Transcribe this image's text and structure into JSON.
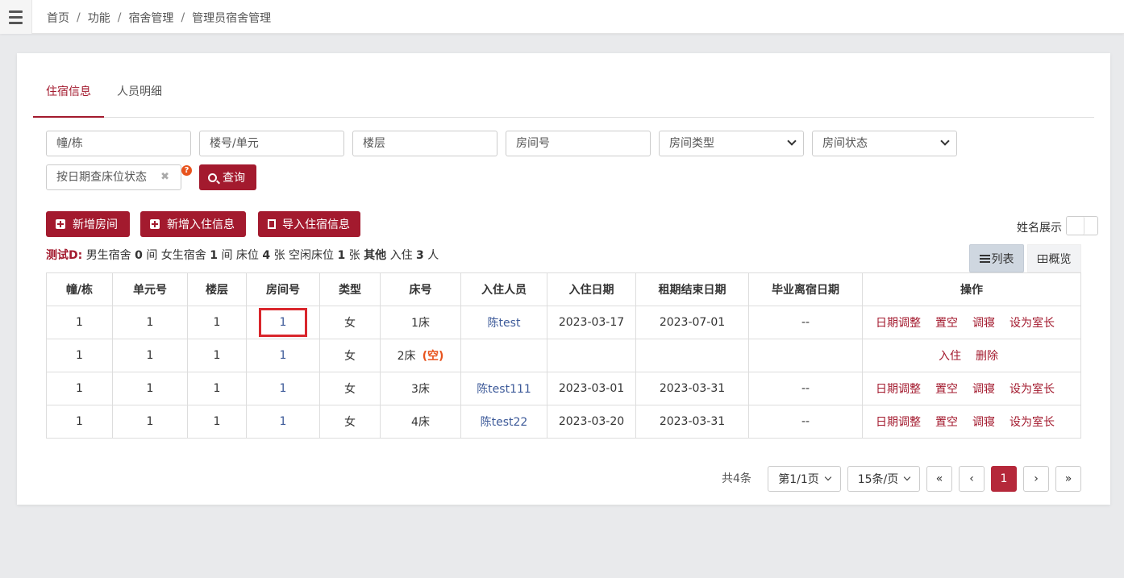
{
  "breadcrumb": [
    "首页",
    "功能",
    "宿舍管理",
    "管理员宿舍管理"
  ],
  "tabs": {
    "active": "住宿信息",
    "inactive": "人员明细"
  },
  "filters": {
    "building": "幢/栋",
    "unit": "楼号/单元",
    "floor": "楼层",
    "room": "房间号",
    "room_type": "房间类型",
    "room_status": "房间状态",
    "date_query": "按日期查床位状态",
    "query_btn": "查询"
  },
  "actions": {
    "add_room": "新增房间",
    "add_checkin": "新增入住信息",
    "import": "导入住宿信息"
  },
  "name_toggle": "姓名展示",
  "summary": {
    "label": "测试D:",
    "male_pre": "男生宿舍",
    "male_count": "0",
    "male_post": "间 女生宿舍",
    "female_count": "1",
    "female_post": "间 床位",
    "bed_count": "4",
    "bed_post": "张 空闲床位",
    "free_count": "1",
    "free_post": "张",
    "other": "其他",
    "checkin_pre": "入住",
    "checkin_count": "3",
    "checkin_post": "人"
  },
  "views": {
    "list": "列表",
    "overview": "概览"
  },
  "table": {
    "headers": [
      "幢/栋",
      "单元号",
      "楼层",
      "房间号",
      "类型",
      "床号",
      "入住人员",
      "入住日期",
      "租期结束日期",
      "毕业离宿日期",
      "操作"
    ],
    "rows": [
      {
        "building": "1",
        "unit": "1",
        "floor": "1",
        "room": "1",
        "type": "女",
        "bed": "1床",
        "empty": "",
        "person": "陈test",
        "in_date": "2023-03-17",
        "end_date": "2023-07-01",
        "grad_date": "--"
      },
      {
        "building": "1",
        "unit": "1",
        "floor": "1",
        "room": "1",
        "type": "女",
        "bed": "2床",
        "empty": "(空)",
        "person": "",
        "in_date": "",
        "end_date": "",
        "grad_date": ""
      },
      {
        "building": "1",
        "unit": "1",
        "floor": "1",
        "room": "1",
        "type": "女",
        "bed": "3床",
        "empty": "",
        "person": "陈test111",
        "in_date": "2023-03-01",
        "end_date": "2023-03-31",
        "grad_date": "--"
      },
      {
        "building": "1",
        "unit": "1",
        "floor": "1",
        "room": "1",
        "type": "女",
        "bed": "4床",
        "empty": "",
        "person": "陈test22",
        "in_date": "2023-03-20",
        "end_date": "2023-03-31",
        "grad_date": "--"
      }
    ],
    "ops_occupied": [
      "日期调整",
      "置空",
      "调寝",
      "设为室长"
    ],
    "ops_empty": [
      "入住",
      "删除"
    ]
  },
  "pager": {
    "total": "共4条",
    "page": "第1/1页",
    "size": "15条/页",
    "first": "«",
    "prev": "‹",
    "current": "1",
    "next": "›",
    "last": "»"
  },
  "colors": {
    "accent": "#a31a2e",
    "link": "#3d5a99",
    "warn": "#e8541e",
    "highlight": "#d9262c"
  }
}
